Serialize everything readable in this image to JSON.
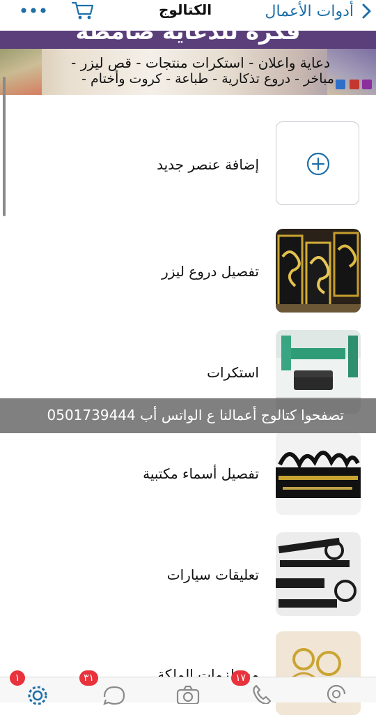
{
  "nav": {
    "back_label": "أدوات الأعمال",
    "title": "الكتالوج"
  },
  "banner": {
    "title": "فكرة للدعاية صامطة",
    "line1": "دعاية واعلان - استكرات منتجات - قص ليزر -",
    "line2": "مباخر - دروع تذكارية - طباعة - كروت وأختام -"
  },
  "add_item": {
    "label": "إضافة عنصر جديد"
  },
  "items": [
    {
      "label": "تفصيل دروع ليزر",
      "thumb": "laser-shields-image"
    },
    {
      "label": "استكرات",
      "thumb": "stickers-room-image"
    },
    {
      "label": "تفصيل أسماء مكتبية",
      "thumb": "desk-names-image"
    },
    {
      "label": "تعليقات سيارات",
      "thumb": "car-hangers-image"
    },
    {
      "label": "مستلزمات الملكة",
      "thumb": "queen-supplies-image"
    }
  ],
  "overlay": {
    "text": "تصفحوا كتالوج أعمالنا ع الواتس أب 0501739444"
  },
  "tabbar": {
    "badges": {
      "updates": "١",
      "chats": "٣١",
      "calls": "١٧"
    }
  },
  "colors": {
    "accent": "#1d6fa8",
    "badge": "#e8323c"
  }
}
